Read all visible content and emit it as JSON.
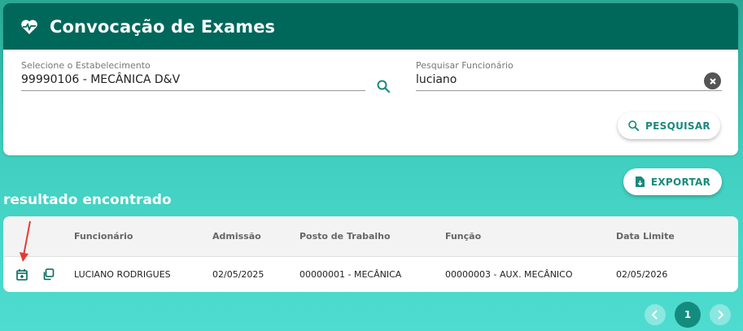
{
  "header": {
    "title": "Convocação de Exames",
    "icon": "heartbeat-icon"
  },
  "filters": {
    "establishment_label": "Selecione o Estabelecimento",
    "establishment_value": "99990106 - MECÂNICA D&V",
    "employee_label": "Pesquisar Funcionário",
    "employee_value": "luciano",
    "search_button": "PESQUISAR"
  },
  "export_button": "EXPORTAR",
  "results": {
    "title": "resultado encontrado",
    "columns": [
      "Funcionário",
      "Admissão",
      "Posto de Trabalho",
      "Função",
      "Data Limite"
    ],
    "rows": [
      {
        "employee": "LUCIANO RODRIGUES",
        "admission": "02/05/2025",
        "workstation": "00000001 - MECÂNICA",
        "function": "00000003 - AUX. MECÂNICO",
        "deadline": "02/05/2026"
      }
    ]
  },
  "pagination": {
    "current_page": "1"
  },
  "colors": {
    "header_bg": "#00675b",
    "accent": "#1a8a7b",
    "page_bg": "#3fcfbf"
  }
}
